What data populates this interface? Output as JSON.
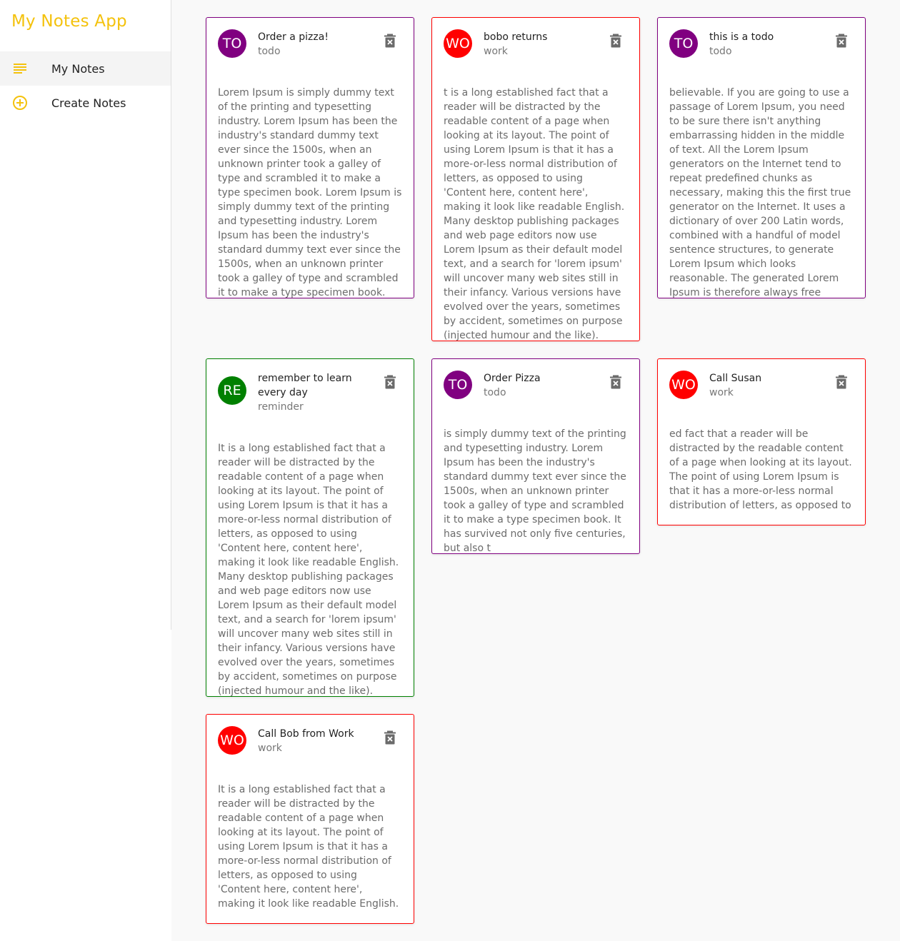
{
  "app": {
    "title": "My Notes App"
  },
  "nav": {
    "items": [
      {
        "label": "My Notes",
        "icon": "notes-list-icon"
      },
      {
        "label": "Create Notes",
        "icon": "add-circle-icon"
      }
    ]
  },
  "colors": {
    "brand": "#f4c20d",
    "todo": "#800080",
    "work": "#ff0000",
    "reminder": "#008000"
  },
  "notes": [
    {
      "avatar": "TO",
      "title": "Order a pizza!",
      "category": "todo",
      "body": "Lorem Ipsum is simply dummy text of the printing and typesetting industry. Lorem Ipsum has been the industry's standard dummy text ever since the 1500s, when an unknown printer took a galley of type and scrambled it to make a type specimen book. Lorem Ipsum is simply dummy text of the printing and typesetting industry. Lorem Ipsum has been the industry's standard dummy text ever since the 1500s, when an unknown printer took a galley of type and scrambled it to make a type specimen book."
    },
    {
      "avatar": "WO",
      "title": "bobo returns",
      "category": "work",
      "body": "t is a long established fact that a reader will be distracted by the readable content of a page when looking at its layout. The point of using Lorem Ipsum is that it has a more-or-less normal distribution of letters, as opposed to using 'Content here, content here', making it look like readable English. Many desktop publishing packages and web page editors now use Lorem Ipsum as their default model text, and a search for 'lorem ipsum' will uncover many web sites still in their infancy. Various versions have evolved over the years, sometimes by accident, sometimes on purpose (injected humour and the like)."
    },
    {
      "avatar": "TO",
      "title": "this is a todo",
      "category": "todo",
      "body": "believable. If you are going to use a passage of Lorem Ipsum, you need to be sure there isn't anything embarrassing hidden in the middle of text. All the Lorem Ipsum generators on the Internet tend to repeat predefined chunks as necessary, making this the first true generator on the Internet. It uses a dictionary of over 200 Latin words, combined with a handful of model sentence structures, to generate Lorem Ipsum which looks reasonable. The generated Lorem Ipsum is therefore always free"
    },
    {
      "avatar": "RE",
      "title": "remember to learn every day",
      "category": "reminder",
      "body": "It is a long established fact that a reader will be distracted by the readable content of a page when looking at its layout. The point of using Lorem Ipsum is that it has a more-or-less normal distribution of letters, as opposed to using 'Content here, content here', making it look like readable English. Many desktop publishing packages and web page editors now use Lorem Ipsum as their default model text, and a search for 'lorem ipsum' will uncover many web sites still in their infancy. Various versions have evolved over the years, sometimes by accident, sometimes on purpose (injected humour and the like)."
    },
    {
      "avatar": "TO",
      "title": "Order Pizza",
      "category": "todo",
      "body": "is simply dummy text of the printing and typesetting industry. Lorem Ipsum has been the industry's standard dummy text ever since the 1500s, when an unknown printer took a galley of type and scrambled it to make a type specimen book. It has survived not only five centuries, but also t"
    },
    {
      "avatar": "WO",
      "title": "Call Susan",
      "category": "work",
      "body": "ed fact that a reader will be distracted by the readable content of a page when looking at its layout. The point of using Lorem Ipsum is that it has a more-or-less normal distribution of letters, as opposed to"
    },
    {
      "avatar": "WO",
      "title": "Call Bob from Work",
      "category": "work",
      "body": "It is a long established fact that a reader will be distracted by the readable content of a page when looking at its layout. The point of using Lorem Ipsum is that it has a more-or-less normal distribution of letters, as opposed to using 'Content here, content here', making it look like readable English."
    }
  ]
}
